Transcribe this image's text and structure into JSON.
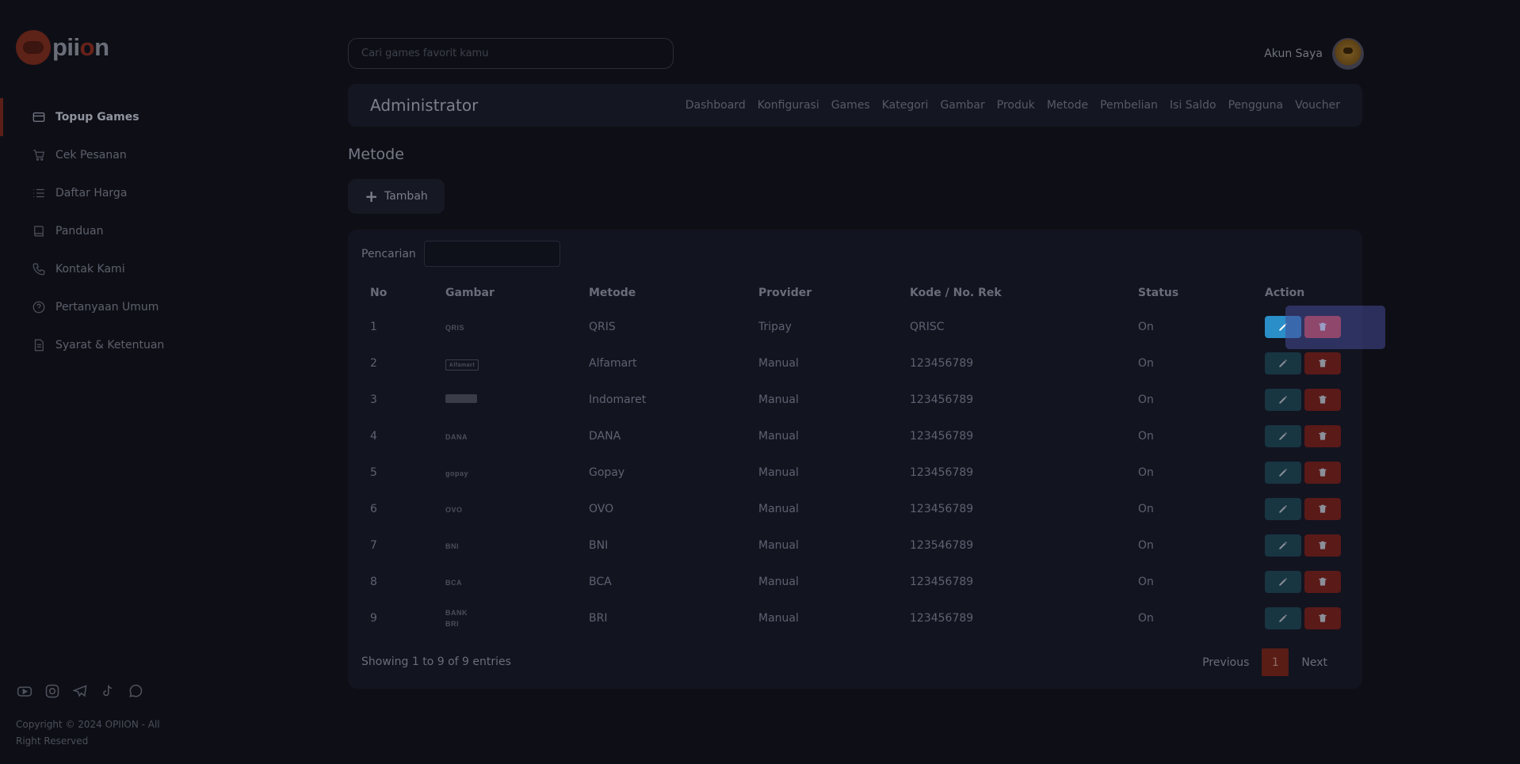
{
  "brand": {
    "name_pre": "pii",
    "name_o": "o",
    "name_post": "n"
  },
  "search": {
    "placeholder": "Cari games favorit kamu"
  },
  "account": {
    "label": "Akun Saya"
  },
  "sidebar": {
    "items": [
      {
        "label": "Topup Games",
        "icon": "card-icon"
      },
      {
        "label": "Cek Pesanan",
        "icon": "cart-icon"
      },
      {
        "label": "Daftar Harga",
        "icon": "list-icon"
      },
      {
        "label": "Panduan",
        "icon": "book-icon"
      },
      {
        "label": "Kontak Kami",
        "icon": "phone-icon"
      },
      {
        "label": "Pertanyaan Umum",
        "icon": "help-icon"
      },
      {
        "label": "Syarat & Ketentuan",
        "icon": "document-icon"
      }
    ],
    "copyright": "Copyright © 2024 OPIION - All Right Reserved"
  },
  "admin": {
    "title": "Administrator",
    "links": [
      "Dashboard",
      "Konfigurasi",
      "Games",
      "Kategori",
      "Gambar",
      "Produk",
      "Metode",
      "Pembelian",
      "Isi Saldo",
      "Pengguna",
      "Voucher"
    ]
  },
  "page": {
    "title": "Metode",
    "add_label": "Tambah"
  },
  "table": {
    "search_label": "Pencarian",
    "headers": [
      "No",
      "Gambar",
      "Metode",
      "Provider",
      "Kode / No. Rek",
      "Status",
      "Action"
    ],
    "rows": [
      {
        "no": "1",
        "logo": "QRIS",
        "metode": "QRIS",
        "provider": "Tripay",
        "kode": "QRISC",
        "status": "On"
      },
      {
        "no": "2",
        "logo": "Alfamart",
        "metode": "Alfamart",
        "provider": "Manual",
        "kode": "123456789",
        "status": "On"
      },
      {
        "no": "3",
        "logo": "",
        "metode": "Indomaret",
        "provider": "Manual",
        "kode": "123456789",
        "status": "On"
      },
      {
        "no": "4",
        "logo": "DANA",
        "metode": "DANA",
        "provider": "Manual",
        "kode": "123456789",
        "status": "On"
      },
      {
        "no": "5",
        "logo": "gopay",
        "metode": "Gopay",
        "provider": "Manual",
        "kode": "123456789",
        "status": "On"
      },
      {
        "no": "6",
        "logo": "OVO",
        "metode": "OVO",
        "provider": "Manual",
        "kode": "123456789",
        "status": "On"
      },
      {
        "no": "7",
        "logo": "BNI",
        "metode": "BNI",
        "provider": "Manual",
        "kode": "123546789",
        "status": "On"
      },
      {
        "no": "8",
        "logo": "BCA",
        "metode": "BCA",
        "provider": "Manual",
        "kode": "123456789",
        "status": "On"
      },
      {
        "no": "9",
        "logo": "BANK BRI",
        "metode": "BRI",
        "provider": "Manual",
        "kode": "123456789",
        "status": "On"
      }
    ],
    "info": "Showing 1 to 9 of 9 entries",
    "pager": {
      "prev": "Previous",
      "current": "1",
      "next": "Next"
    }
  },
  "colors": {
    "accent": "#e8443a",
    "edit": "#2a8ec8",
    "background": "#0e0f16"
  }
}
